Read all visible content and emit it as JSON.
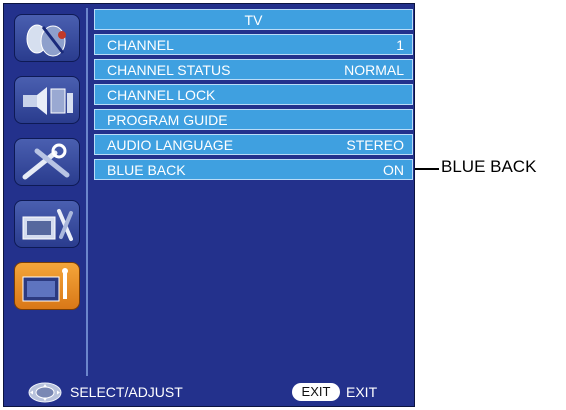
{
  "menu": {
    "title": "TV",
    "items": [
      {
        "label": "CHANNEL",
        "value": "1"
      },
      {
        "label": "CHANNEL STATUS",
        "value": "NORMAL"
      },
      {
        "label": "CHANNEL LOCK",
        "value": ""
      },
      {
        "label": "PROGRAM GUIDE",
        "value": ""
      },
      {
        "label": "AUDIO LANGUAGE",
        "value": "STEREO"
      },
      {
        "label": "BLUE BACK",
        "value": "ON"
      }
    ]
  },
  "sidebar": {
    "icons": [
      {
        "name": "picture-settings-icon"
      },
      {
        "name": "audio-settings-icon"
      },
      {
        "name": "tools-settings-icon"
      },
      {
        "name": "setup-settings-icon"
      },
      {
        "name": "tv-settings-icon",
        "active": true
      }
    ]
  },
  "footer": {
    "select_label": "SELECT/ADJUST",
    "exit_button_label": "EXIT",
    "exit_label": "EXIT"
  },
  "callout": {
    "label": "BLUE BACK"
  },
  "colors": {
    "panel": "#23318c",
    "row": "#3fa0e0",
    "active_icon": "#f0a030"
  }
}
